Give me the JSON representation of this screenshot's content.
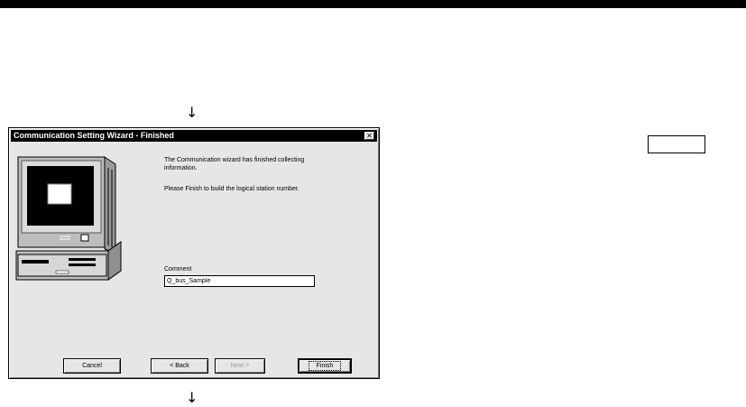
{
  "window": {
    "title": "Communication Setting Wizard - Finished",
    "close_glyph": "✕",
    "message_line1": "The Communication wizard has finished collecting",
    "message_line2": "information.",
    "message_line3": "Please Finish to build the logical station number.",
    "comment_label": "Comment",
    "comment_value": "Q_bus_Sample",
    "buttons": {
      "cancel": "Cancel",
      "back": "< Back",
      "next": "Next >",
      "finish": "Finish"
    }
  },
  "arrows": {
    "top": "↓",
    "bottom": "↓"
  },
  "icons": {
    "illustration": "computer-monitor-icon",
    "close": "close-icon"
  }
}
